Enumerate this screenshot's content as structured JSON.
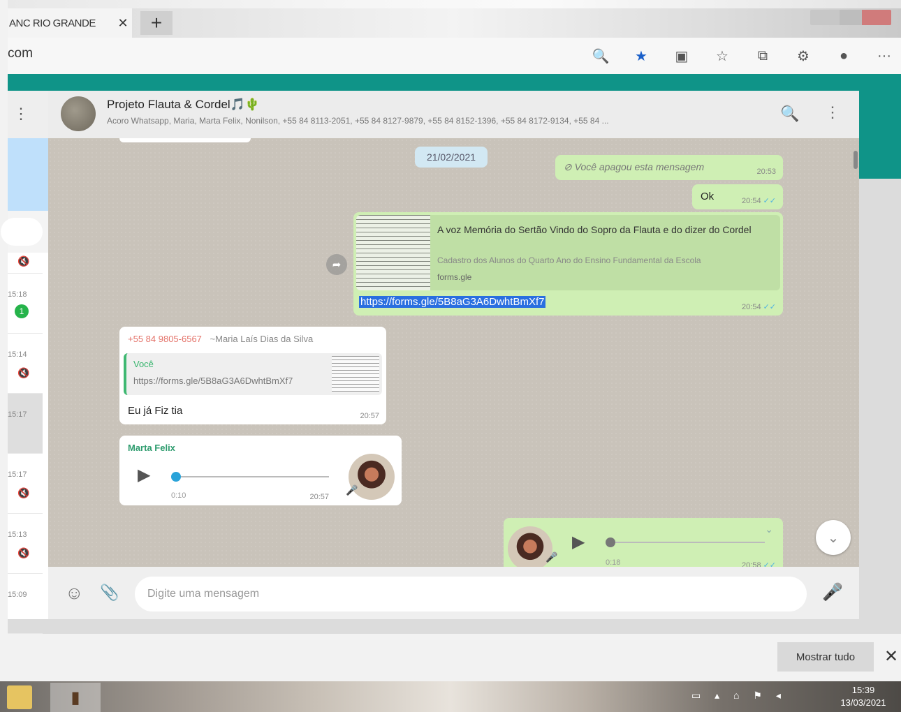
{
  "browser": {
    "tab_title": "ANC RIO GRANDE",
    "tab_close": "✕",
    "new_tab": "+",
    "url": "com",
    "icons": [
      "zoom-icon",
      "favorite-star-icon",
      "collections-icon",
      "favorites-icon",
      "tab-icon",
      "extensions-icon",
      "profile-icon",
      "more-icon"
    ],
    "icon_glyphs": [
      "🔍",
      "★",
      "▣",
      "☆",
      "⧉",
      "⚙",
      "●",
      "···"
    ]
  },
  "sidebar": {
    "menu": "⋮",
    "rows": [
      {
        "time": "",
        "meta": "🔇"
      },
      {
        "time": "15:18",
        "badge": "1"
      },
      {
        "time": "15:14",
        "meta": "🔇"
      },
      {
        "time": "15:17",
        "meta": ""
      },
      {
        "time": "15:17",
        "meta": "🔇"
      },
      {
        "time": "15:13",
        "meta": "🔇"
      },
      {
        "time": "15:09",
        "meta": ""
      }
    ]
  },
  "chat": {
    "name": "Projeto Flauta & Cordel🎵🌵",
    "members": "Acoro Whatsapp, Maria, Marta Felix, Nonilson, +55 84 8113-2051, +55 84 8127-9879, +55 84 8152-1396, +55 84 8172-9134, +55 84 ...",
    "search": "🔍",
    "menu": "⋮"
  },
  "messages": {
    "date_chip": "21/02/2021",
    "deleted": {
      "text": "⊘ Você apagou esta mensagem",
      "time": "20:53"
    },
    "ok": {
      "text": "Ok",
      "time": "20:54"
    },
    "link": {
      "title": "A voz Memória do Sertão Vindo do Sopro da Flauta e do dizer do Cordel",
      "desc": "Cadastro dos Alunos do Quarto Ano do Ensino Fundamental da Escola",
      "domain": "forms.gle",
      "url": "https://forms.gle/5B8aG3A6DwhtBmXf7",
      "time": "20:54"
    },
    "quote": {
      "sender_phone": "+55 84 9805-6567",
      "sender_name": "~Maria Laís Dias da Silva",
      "quoted_author": "Você",
      "quoted_text": "https://forms.gle/5B8aG3A6DwhtBmXf7",
      "body": "Eu já Fiz tia",
      "time": "20:57"
    },
    "audio_in": {
      "sender": "Marta Felix",
      "duration": "0:10",
      "time": "20:57"
    },
    "audio_out": {
      "duration": "0:18",
      "time": "20:58"
    }
  },
  "composer": {
    "placeholder": "Digite uma mensagem",
    "emoji": "☺",
    "clip": "📎",
    "mic": "🎤"
  },
  "download_bar": {
    "show_all": "Mostrar tudo",
    "close": "✕"
  },
  "taskbar": {
    "clock_time": "15:39",
    "clock_date": "13/03/2021"
  }
}
